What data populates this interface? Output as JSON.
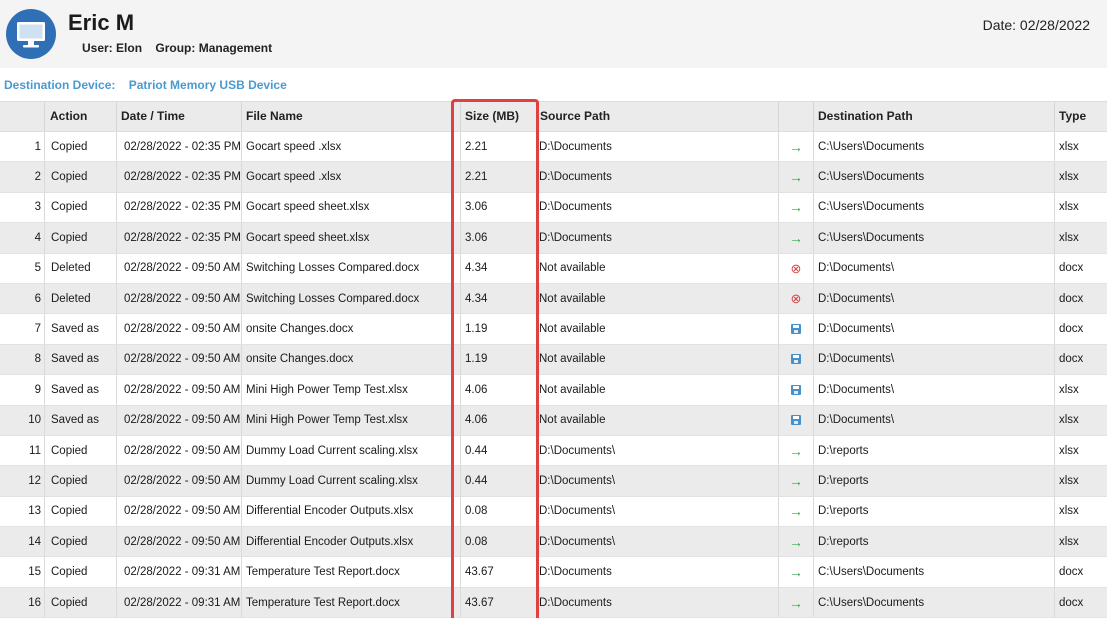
{
  "header": {
    "name": "Eric M",
    "user_label": "User:",
    "user_value": "Elon",
    "group_label": "Group:",
    "group_value": "Management",
    "date_text": "Date: 02/28/2022",
    "avatar_icon": "computer-monitor-icon"
  },
  "destination": {
    "label": "Destination Device:",
    "value": "Patriot Memory USB Device"
  },
  "table": {
    "columns": [
      "",
      "Action",
      "Date / Time",
      "File Name",
      "Size (MB)",
      "Source Path",
      "",
      "Destination Path",
      "Type"
    ],
    "rows": [
      {
        "num": "1",
        "action": "Copied",
        "datetime": "02/28/2022 - 02:35 PM",
        "file": "Gocart speed .xlsx",
        "size": "2.21",
        "source": "D:\\Documents",
        "icon": "green-arrow-right-icon",
        "dest": "C:\\Users\\Documents",
        "type": "xlsx"
      },
      {
        "num": "2",
        "action": "Copied",
        "datetime": "02/28/2022 - 02:35 PM",
        "file": "Gocart speed .xlsx",
        "size": "2.21",
        "source": "D:\\Documents",
        "icon": "green-arrow-right-icon",
        "dest": "C:\\Users\\Documents",
        "type": "xlsx"
      },
      {
        "num": "3",
        "action": "Copied",
        "datetime": "02/28/2022 - 02:35 PM",
        "file": "Gocart speed sheet.xlsx",
        "size": "3.06",
        "source": "D:\\Documents",
        "icon": "green-arrow-right-icon",
        "dest": "C:\\Users\\Documents",
        "type": "xlsx"
      },
      {
        "num": "4",
        "action": "Copied",
        "datetime": "02/28/2022 - 02:35 PM",
        "file": "Gocart speed sheet.xlsx",
        "size": "3.06",
        "source": "D:\\Documents",
        "icon": "green-arrow-right-icon",
        "dest": "C:\\Users\\Documents",
        "type": "xlsx"
      },
      {
        "num": "5",
        "action": "Deleted",
        "datetime": "02/28/2022 - 09:50 AM",
        "file": "Switching Losses Compared.docx",
        "size": "4.34",
        "source": "Not available",
        "icon": "red-circle-x-icon",
        "dest": "D:\\Documents\\",
        "type": "docx"
      },
      {
        "num": "6",
        "action": "Deleted",
        "datetime": "02/28/2022 - 09:50 AM",
        "file": "Switching Losses Compared.docx",
        "size": "4.34",
        "source": "Not available",
        "icon": "red-circle-x-icon",
        "dest": "D:\\Documents\\",
        "type": "docx"
      },
      {
        "num": "7",
        "action": "Saved as",
        "datetime": "02/28/2022 - 09:50 AM",
        "file": "onsite Changes.docx",
        "size": "1.19",
        "source": "Not available",
        "icon": "blue-floppy-disk-icon",
        "dest": "D:\\Documents\\",
        "type": "docx"
      },
      {
        "num": "8",
        "action": "Saved as",
        "datetime": "02/28/2022 - 09:50 AM",
        "file": "onsite Changes.docx",
        "size": "1.19",
        "source": "Not available",
        "icon": "blue-floppy-disk-icon",
        "dest": "D:\\Documents\\",
        "type": "docx"
      },
      {
        "num": "9",
        "action": "Saved as",
        "datetime": "02/28/2022 - 09:50 AM",
        "file": "Mini High Power Temp Test.xlsx",
        "size": "4.06",
        "source": "Not available",
        "icon": "blue-floppy-disk-icon",
        "dest": "D:\\Documents\\",
        "type": "xlsx"
      },
      {
        "num": "10",
        "action": "Saved as",
        "datetime": "02/28/2022 - 09:50 AM",
        "file": "Mini High Power Temp Test.xlsx",
        "size": "4.06",
        "source": "Not available",
        "icon": "blue-floppy-disk-icon",
        "dest": "D:\\Documents\\",
        "type": "xlsx"
      },
      {
        "num": "11",
        "action": "Copied",
        "datetime": "02/28/2022 - 09:50 AM",
        "file": "Dummy Load Current scaling.xlsx",
        "size": "0.44",
        "source": "D:\\Documents\\",
        "icon": "green-arrow-right-icon",
        "dest": "D:\\reports",
        "type": "xlsx"
      },
      {
        "num": "12",
        "action": "Copied",
        "datetime": "02/28/2022 - 09:50 AM",
        "file": "Dummy Load Current scaling.xlsx",
        "size": "0.44",
        "source": "D:\\Documents\\",
        "icon": "green-arrow-right-icon",
        "dest": "D:\\reports",
        "type": "xlsx"
      },
      {
        "num": "13",
        "action": "Copied",
        "datetime": "02/28/2022 - 09:50 AM",
        "file": "Differential Encoder Outputs.xlsx",
        "size": "0.08",
        "source": "D:\\Documents\\",
        "icon": "green-arrow-right-icon",
        "dest": "D:\\reports",
        "type": "xlsx"
      },
      {
        "num": "14",
        "action": "Copied",
        "datetime": "02/28/2022 - 09:50 AM",
        "file": "Differential Encoder Outputs.xlsx",
        "size": "0.08",
        "source": "D:\\Documents\\",
        "icon": "green-arrow-right-icon",
        "dest": "D:\\reports",
        "type": "xlsx"
      },
      {
        "num": "15",
        "action": "Copied",
        "datetime": "02/28/2022 - 09:31 AM",
        "file": "Temperature Test Report.docx",
        "size": "43.67",
        "source": "D:\\Documents",
        "icon": "green-arrow-right-icon",
        "dest": "C:\\Users\\Documents",
        "type": "docx"
      },
      {
        "num": "16",
        "action": "Copied",
        "datetime": "02/28/2022 - 09:31 AM",
        "file": "Temperature Test Report.docx",
        "size": "43.67",
        "source": "D:\\Documents",
        "icon": "green-arrow-right-icon",
        "dest": "C:\\Users\\Documents",
        "type": "docx"
      }
    ]
  },
  "colors": {
    "accent_blue": "#4a9ad0",
    "highlight_red": "#e04040",
    "arrow_green": "#3aa64a",
    "delete_red": "#d04848",
    "save_blue": "#4a90c8"
  }
}
